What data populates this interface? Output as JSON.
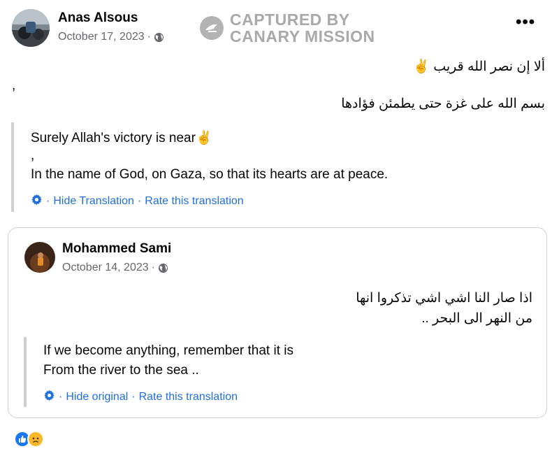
{
  "post": {
    "author": "Anas Alsous",
    "date": "October 17, 2023",
    "date_sep": "·",
    "privacy_icon": "globe-icon",
    "arabic_line1": "ألا إن نصر الله قريب",
    "arabic_line1_emoji": "✌",
    "comma": ",",
    "arabic_line2": "بسم الله على غزة حتى يطمئن فؤادها",
    "translation_line1": "Surely Allah's victory is near",
    "translation_emoji": "✌",
    "translation_comma": ",",
    "translation_line2": "In the name of God, on Gaza, so that its hearts are at peace.",
    "hide_translation": "Hide Translation",
    "rate_translation": "Rate this translation",
    "link_sep": "·"
  },
  "watermark": {
    "line1": "CAPTURED BY",
    "line2": "CANARY MISSION"
  },
  "shared": {
    "author": "Mohammed Sami",
    "date": "October 14, 2023",
    "date_sep": "·",
    "privacy_icon": "globe-icon",
    "arabic_line1": "اذا صار النا اشي اشي تذكروا انها",
    "arabic_line2": "من النهر الى البحر ..",
    "translation_line1": "If we become anything, remember that it is",
    "translation_line2": "From the river to the sea ..",
    "hide_original": "Hide original",
    "rate_translation": "Rate this translation",
    "link_sep": "·"
  },
  "reactions": {
    "icons": [
      "like-icon",
      "sad-icon"
    ]
  },
  "colors": {
    "link": "#216fdb",
    "meta": "#65676b",
    "like": "#1877f2",
    "sad": "#f7b928"
  }
}
